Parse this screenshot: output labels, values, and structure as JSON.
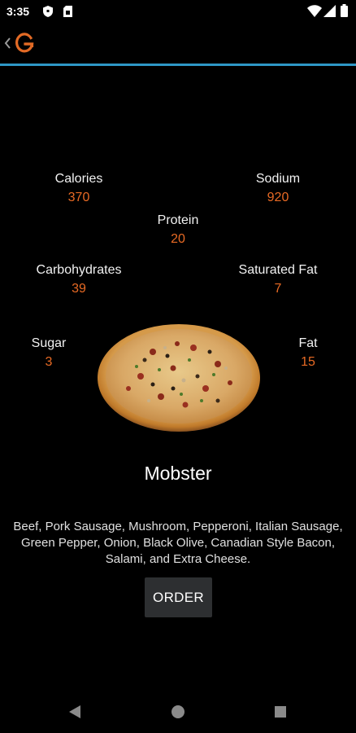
{
  "status_bar": {
    "time": "3:35",
    "left_icons": [
      "shield-icon",
      "sim-card-icon"
    ],
    "right_icons": [
      "wifi-icon",
      "signal-icon",
      "battery-icon"
    ]
  },
  "app_bar": {
    "logo_icon": "g-logo-icon",
    "accent_color": "#2e97c6",
    "logo_color": "#e26a25"
  },
  "nutrition": {
    "calories": {
      "label": "Calories",
      "value": "370"
    },
    "sodium": {
      "label": "Sodium",
      "value": "920"
    },
    "protein": {
      "label": "Protein",
      "value": "20"
    },
    "carbohydrates": {
      "label": "Carbohydrates",
      "value": "39"
    },
    "saturated_fat": {
      "label": "Saturated Fat",
      "value": "7"
    },
    "sugar": {
      "label": "Sugar",
      "value": "3"
    },
    "fat": {
      "label": "Fat",
      "value": "15"
    },
    "value_color": "#e86a24"
  },
  "product": {
    "name": "Mobster",
    "description": "Beef, Pork Sausage, Mushroom, Pepperoni, Italian Sausage, Green Pepper, Onion, Black Olive, Canadian Style Bacon, Salami, and Extra Cheese.",
    "order_label": "ORDER"
  },
  "nav_bar": {
    "icons": [
      "back-triangle-icon",
      "home-circle-icon",
      "recents-square-icon"
    ]
  }
}
